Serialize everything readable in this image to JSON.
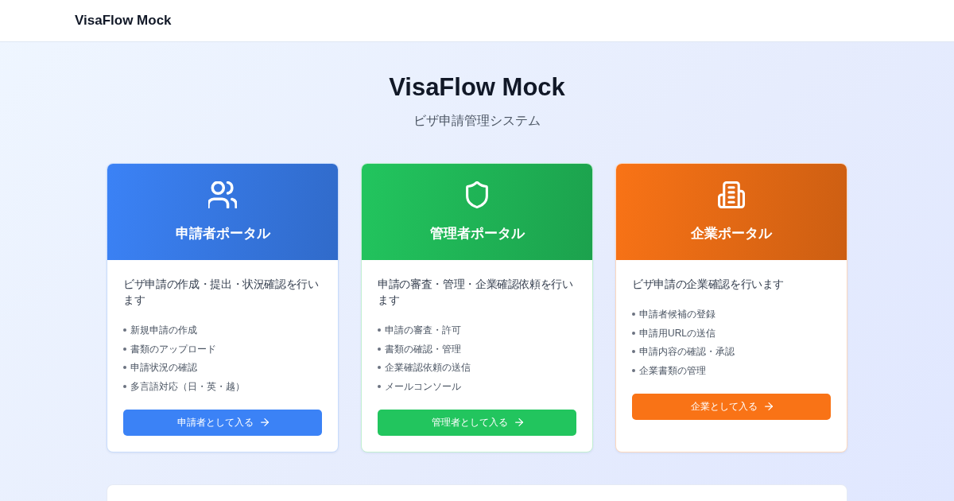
{
  "header": {
    "brand": "VisaFlow Mock"
  },
  "hero": {
    "title": "VisaFlow Mock",
    "subtitle": "ビザ申請管理システム"
  },
  "portals": [
    {
      "kind": "applicant",
      "color": "#3b82f6",
      "title": "申請者ポータル",
      "description": "ビザ申請の作成・提出・状況確認を行います",
      "features": [
        "新規申請の作成",
        "書類のアップロード",
        "申請状況の確認",
        "多言語対応（日・英・越）"
      ],
      "button": "申請者として入る"
    },
    {
      "kind": "admin",
      "color": "#22c55e",
      "title": "管理者ポータル",
      "description": "申請の審査・管理・企業確認依頼を行います",
      "features": [
        "申請の審査・許可",
        "書類の確認・管理",
        "企業確認依頼の送信",
        "メールコンソール"
      ],
      "button": "管理者として入る"
    },
    {
      "kind": "company",
      "color": "#f97316",
      "title": "企業ポータル",
      "description": "ビザ申請の企業確認を行います",
      "features": [
        "申請者候補の登録",
        "申請用URLの送信",
        "申請内容の確認・承認",
        "企業書類の管理"
      ],
      "button": "企業として入る"
    }
  ]
}
